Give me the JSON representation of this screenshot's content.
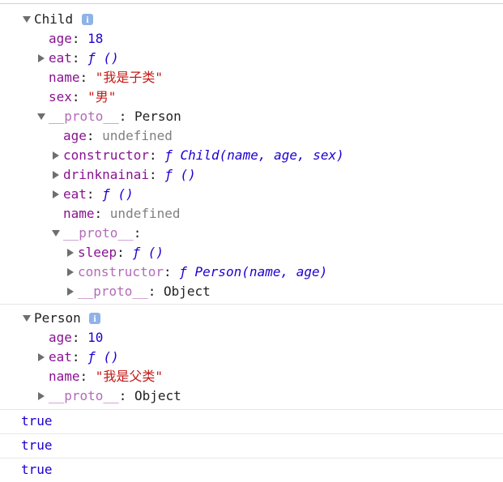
{
  "child": {
    "header": "Child",
    "info": "i",
    "age_key": "age",
    "age_val": "18",
    "eat_key": "eat",
    "eat_val": "ƒ ()",
    "name_key": "name",
    "name_val": "\"我是子类\"",
    "sex_key": "sex",
    "sex_val": "\"男\"",
    "proto_key": "__proto__",
    "proto_val": "Person",
    "proto": {
      "age_key": "age",
      "age_val": "undefined",
      "constructor_key": "constructor",
      "constructor_val": "ƒ Child(name, age, sex)",
      "drink_key": "drinknainai",
      "drink_val": "ƒ ()",
      "eat_key": "eat",
      "eat_val": "ƒ ()",
      "name_key": "name",
      "name_val": "undefined",
      "proto_key": "__proto__",
      "proto_val": "",
      "proto": {
        "sleep_key": "sleep",
        "sleep_val": "ƒ ()",
        "constructor_key": "constructor",
        "constructor_val": "ƒ Person(name, age)",
        "proto_key": "__proto__",
        "proto_val": "Object"
      }
    }
  },
  "person": {
    "header": "Person",
    "info": "i",
    "age_key": "age",
    "age_val": "10",
    "eat_key": "eat",
    "eat_val": "ƒ ()",
    "name_key": "name",
    "name_val": "\"我是父类\"",
    "proto_key": "__proto__",
    "proto_val": "Object"
  },
  "results": [
    "true",
    "true",
    "true"
  ],
  "sep": ": ",
  "colors": {
    "key": "#881391",
    "number": "#1c00cf",
    "string": "#c41a16",
    "undefined": "#808080"
  }
}
